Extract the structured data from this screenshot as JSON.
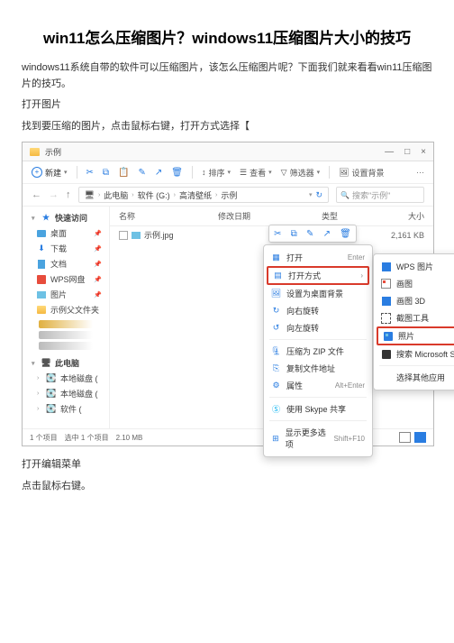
{
  "article": {
    "title": "win11怎么压缩图片？windows11压缩图片大小的技巧",
    "intro": "windows11系统自带的软件可以压缩图片，该怎么压缩图片呢？下面我们就来看看win11压缩图片的技巧。",
    "step1_title": "打开图片",
    "step1_body": "找到要压缩的图片，点击鼠标右键，打开方式选择【",
    "step2_title": "打开编辑菜单",
    "step2_body": "点击鼠标右键。"
  },
  "explorer": {
    "window_title": "示例",
    "controls": {
      "min": "—",
      "max": "□",
      "close": "×"
    },
    "toolbar": {
      "new": "新建",
      "sort": "排序",
      "view": "查看",
      "filter": "筛选器",
      "settings": "设置背景"
    },
    "breadcrumb": [
      "此电脑",
      "软件 (G:)",
      "高清壁纸",
      "示例"
    ],
    "search_placeholder": "搜索\"示例\"",
    "columns": {
      "name": "名称",
      "date": "修改日期",
      "type": "类型",
      "size": "大小"
    },
    "file": {
      "name": "示例.jpg",
      "size": "2,161 KB"
    },
    "context_menu": {
      "open": "打开",
      "open_shortcut": "Enter",
      "open_with": "打开方式",
      "set_bg": "设置为桌面背景",
      "rotate_right": "向右旋转",
      "rotate_left": "向左旋转",
      "compress_zip": "压缩为 ZIP 文件",
      "copy_path": "复制文件地址",
      "properties": "属性",
      "properties_shortcut": "Alt+Enter",
      "skype_share": "使用 Skype 共享",
      "show_more": "显示更多选项",
      "show_more_shortcut": "Shift+F10"
    },
    "open_with_menu": {
      "wps": "WPS 图片",
      "paint": "画图",
      "paint3d": "画图 3D",
      "snip": "截图工具",
      "photos": "照片",
      "store": "搜索 Microsoft Store",
      "choose": "选择其他应用"
    },
    "sidebar": {
      "quick": "快速访问",
      "desktop": "桌面",
      "downloads": "下载",
      "documents": "文档",
      "wps": "WPS网盘",
      "pictures": "图片",
      "sample_folder": "示例父文件夹",
      "this_pc": "此电脑",
      "local_disk": "本地磁盘 (",
      "soft_disk": "软件 ("
    },
    "status": "1 个项目　选中 1 个项目　2.10 MB"
  }
}
